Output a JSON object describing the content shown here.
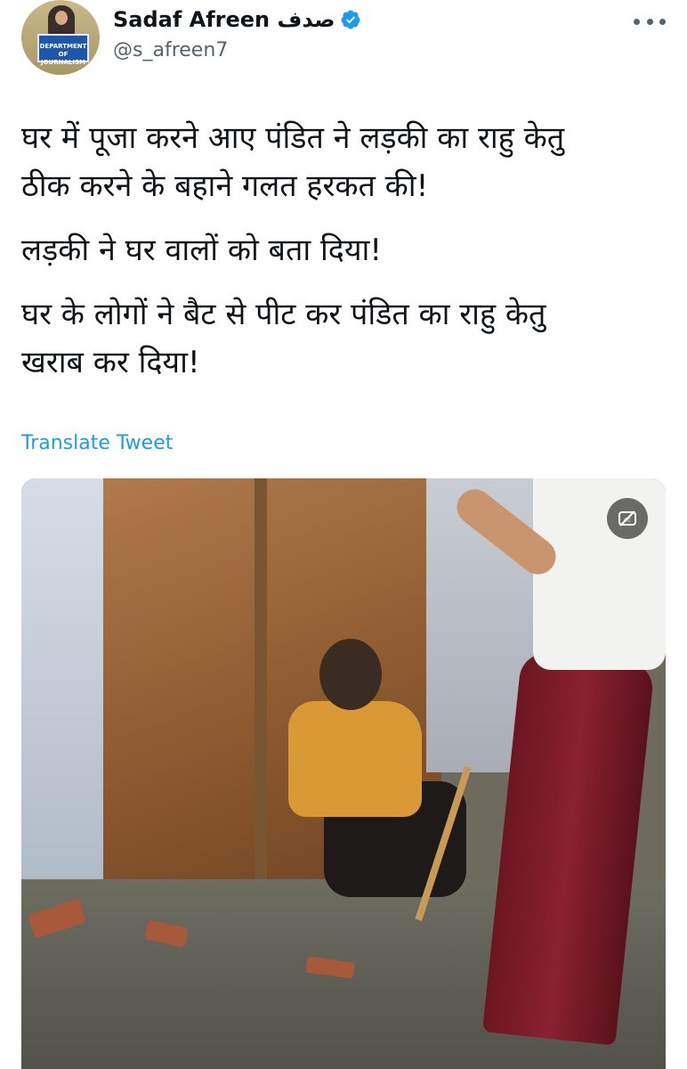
{
  "tweet": {
    "author": {
      "display_name": "Sadaf Afreen صدف",
      "handle": "@s_afreen7",
      "verified": true,
      "avatar_podium_text": "DEPARTMENT OF JOURNALISM",
      "avatar_icon": "avatar-photo"
    },
    "more_icon": "more-horizontal-icon",
    "paragraphs": [
      "घर में पूजा करने आए पंडित ने लड़की का राहु केतु\nठीक करने के बहाने गलत हरकत की!",
      "लड़की ने घर वालों को बता दिया!",
      "घर के लोगों ने बैट से पीट कर पंडित का राहु केतु\nखराब कर दिया!"
    ],
    "translate_label": "Translate Tweet",
    "media": {
      "type": "video-still",
      "caption_button_icon": "captions-off-icon"
    }
  },
  "colors": {
    "text_primary": "#0f1419",
    "text_secondary": "#536471",
    "link": "#1d9bf0",
    "verified_badge": "#1d9bf0"
  }
}
